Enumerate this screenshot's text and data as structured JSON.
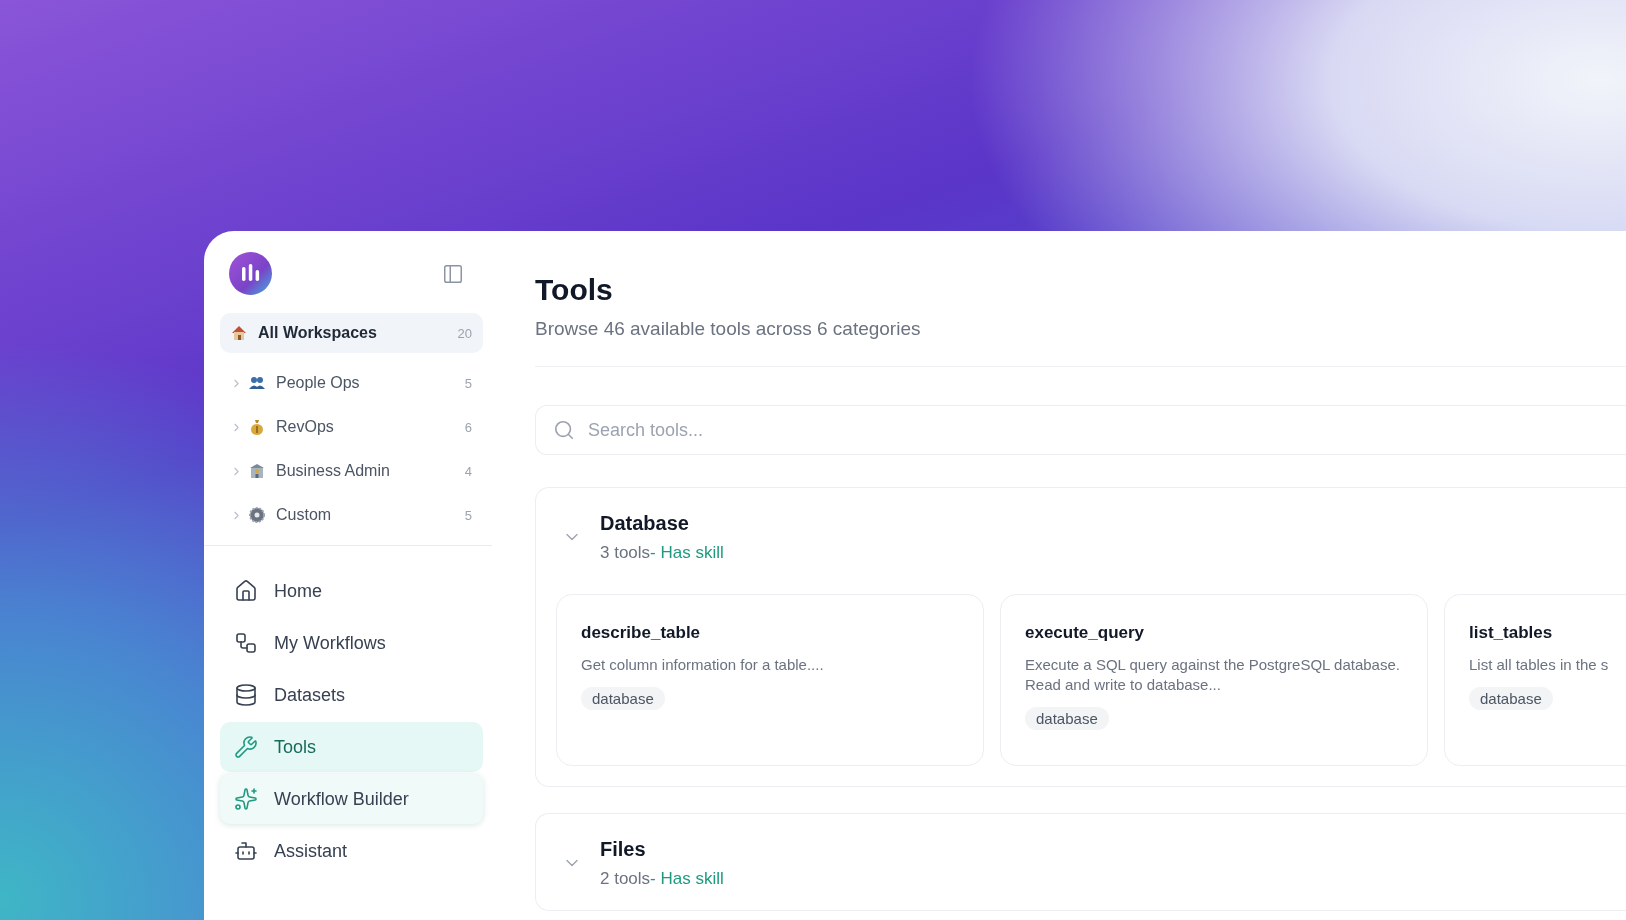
{
  "sidebar": {
    "workspaces": [
      {
        "label": "All Workspaces",
        "count": "20",
        "selected": true
      },
      {
        "label": "People Ops",
        "count": "5",
        "selected": false,
        "expanded": false
      },
      {
        "label": "RevOps",
        "count": "6",
        "selected": false,
        "expanded": false
      },
      {
        "label": "Business Admin",
        "count": "4",
        "selected": false,
        "expanded": false
      },
      {
        "label": "Custom",
        "count": "5",
        "selected": false,
        "expanded": false
      }
    ],
    "nav": [
      {
        "label": "Home",
        "selected": false,
        "hovered": false
      },
      {
        "label": "My Workflows",
        "selected": false,
        "hovered": false
      },
      {
        "label": "Datasets",
        "selected": false,
        "hovered": false
      },
      {
        "label": "Tools",
        "selected": true,
        "hovered": false
      },
      {
        "label": "Workflow Builder",
        "selected": false,
        "hovered": true
      },
      {
        "label": "Assistant",
        "selected": false,
        "hovered": false
      }
    ]
  },
  "main": {
    "title": "Tools",
    "subtitle": "Browse 46 available tools across 6 categories",
    "search": {
      "placeholder": "Search tools..."
    },
    "categories": [
      {
        "name": "Database",
        "count": "3 tools",
        "skill": "- Has skill",
        "expanded": true,
        "tools": [
          {
            "name": "describe_table",
            "description": "Get column information for a table....",
            "tag": "database"
          },
          {
            "name": "execute_query",
            "description": "Execute a SQL query against the PostgreSQL database. Read and write to database...",
            "tag": "database"
          },
          {
            "name": "list_tables",
            "description": "List all tables in the s",
            "tag": "database"
          }
        ]
      },
      {
        "name": "Files",
        "count": "2 tools",
        "skill": "- Has skill",
        "expanded": true
      }
    ]
  }
}
